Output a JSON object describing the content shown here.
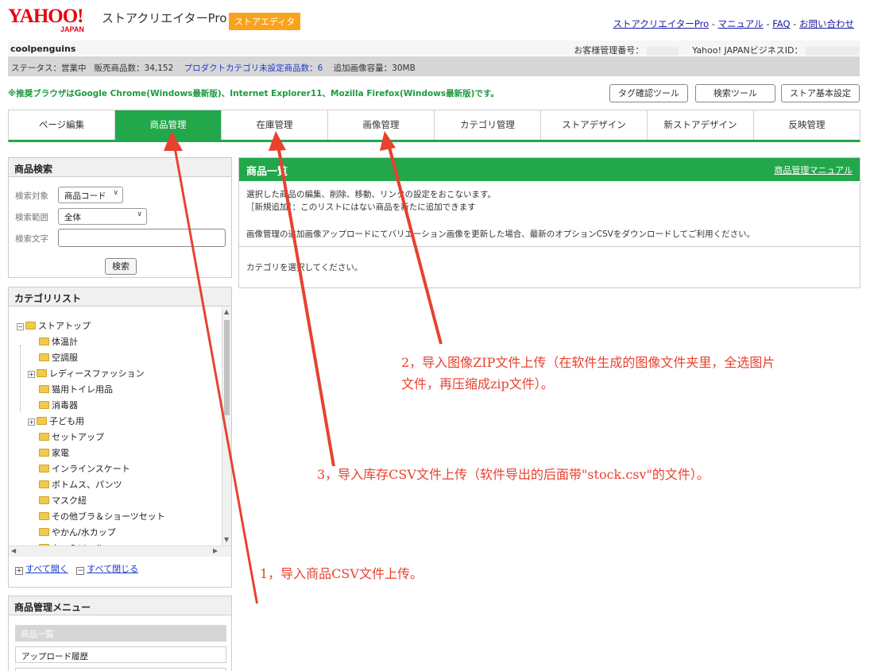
{
  "header": {
    "logo_main": "YAHOO!",
    "logo_sub": "JAPAN",
    "app_title": "ストアクリエイターPro",
    "badge": "ストアエディタ",
    "links": [
      "ストアクリエイターPro",
      "マニュアル",
      "FAQ",
      "お問い合わせ"
    ],
    "link_separator": "-"
  },
  "store": {
    "name": "coolpenguins",
    "customer_no_label": "お客様管理番号：",
    "business_id_label": "Yahoo! JAPANビジネスID："
  },
  "status": {
    "status_text": "ステータス：営業中",
    "product_count": "販売商品数：34,152",
    "uncategorized": "プロダクトカテゴリ未設定商品数：6",
    "extra_image": "追加画像容量：30MB"
  },
  "browser_note": "※推奨ブラウザはGoogle Chrome(Windows最新版)、Internet Explorer11、Mozilla Firefox(Windows最新版)です。",
  "tools": [
    "タグ確認ツール",
    "検索ツール",
    "ストア基本設定"
  ],
  "tabs": [
    "ページ編集",
    "商品管理",
    "在庫管理",
    "画像管理",
    "カテゴリ管理",
    "ストアデザイン",
    "新ストアデザイン",
    "反映管理"
  ],
  "active_tab": 1,
  "search": {
    "title": "商品検索",
    "target_label": "検索対象",
    "target_value": "商品コード",
    "range_label": "検索範囲",
    "range_value": "全体",
    "text_label": "検索文字",
    "text_value": "",
    "button": "検索"
  },
  "category": {
    "title": "カテゴリリスト",
    "root": "ストアトップ",
    "items": [
      {
        "label": "体温計",
        "expandable": false
      },
      {
        "label": "空調服",
        "expandable": false
      },
      {
        "label": "レディースファッション",
        "expandable": true
      },
      {
        "label": "猫用トイレ用品",
        "expandable": false
      },
      {
        "label": "消毒器",
        "expandable": false
      },
      {
        "label": "子ども用",
        "expandable": true
      },
      {
        "label": "セットアップ",
        "expandable": false
      },
      {
        "label": "家電",
        "expandable": false
      },
      {
        "label": "インラインスケート",
        "expandable": false
      },
      {
        "label": "ボトムス、パンツ",
        "expandable": false
      },
      {
        "label": "マスク紐",
        "expandable": false
      },
      {
        "label": "その他ブラ＆ショーツセット",
        "expandable": false
      },
      {
        "label": "やかん/水カップ",
        "expandable": false
      },
      {
        "label": "キャミソール",
        "expandable": false
      }
    ],
    "expand_all": "すべて開く",
    "collapse_all": "すべて閉じる"
  },
  "menu": {
    "title": "商品管理メニュー",
    "items": [
      "商品一覧",
      "アップロード履歴"
    ]
  },
  "main": {
    "title": "商品一覧",
    "manual_link": "商品管理マニュアル",
    "desc1": "選択した商品の編集、削除、移動、リンクの設定をおこないます。",
    "desc2": "［新規追加］：このリストにはない商品を新たに追加できます",
    "desc3": "画像管理の追加画像アップロードにてバリエーション画像を更新した場合、最新のオプションCSVをダウンロードしてご利用ください。",
    "empty_message": "カテゴリを選択してください。"
  },
  "annotations": {
    "note1": "1，导入商品CSV文件上传。",
    "note2_line1": "2，导入图像ZIP文件上传（在软件生成的图像文件夹里，全选图片",
    "note2_line2": "文件，再压缩成zip文件）。",
    "note3": "3，导入库存CSV文件上传（软件导出的后面带\"stock.csv\"的文件）。",
    "arrow_color": "#e8412f"
  }
}
